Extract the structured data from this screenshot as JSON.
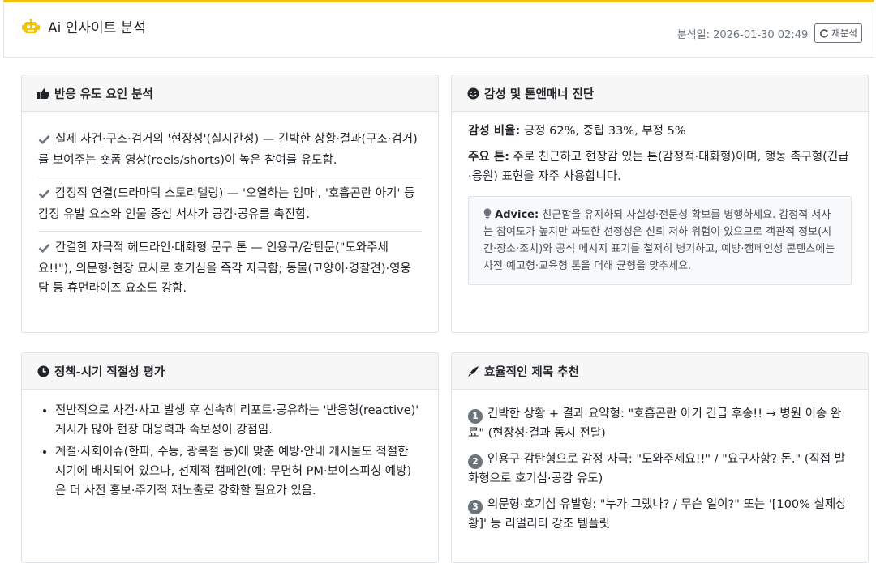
{
  "header": {
    "title": "Ai 인사이트 분석",
    "date_label": "분석일: 2026-01-30 02:49",
    "reanalyze_label": "재분석"
  },
  "response_factors": {
    "title": "반응 유도 요인 분석",
    "items": [
      "실제 사건·구조·검거의 '현장성'(실시간성) — 긴박한 상황·결과(구조·검거)를 보여주는 숏폼 영상(reels/shorts)이 높은 참여를 유도함.",
      "감정적 연결(드라마틱 스토리텔링) — '오열하는 엄마', '호흡곤란 아기' 등 감정 유발 요소와 인물 중심 서사가 공감·공유를 촉진함.",
      "간결한 자극적 헤드라인·대화형 문구 톤 — 인용구/감탄문(\"도와주세요!!\"), 의문형·현장 묘사로 호기심을 즉각 자극함; 동물(고양이·경찰견)·영웅담 등 휴먼라이즈 요소도 강함."
    ]
  },
  "sentiment": {
    "title": "감성 및 톤앤매너 진단",
    "ratio_label": "감성 비율:",
    "ratio_value": " 긍정 62%, 중립 33%, 부정 5%",
    "tone_label": "주요 톤:",
    "tone_value": " 주로 친근하고 현장감 있는 톤(감정적·대화형)이며, 행동 촉구형(긴급·응원) 표현을 자주 사용합니다.",
    "advice_label": "Advice:",
    "advice_text": " 친근함을 유지하되 사실성·전문성 확보를 병행하세요. 감정적 서사는 참여도가 높지만 과도한 선정성은 신뢰 저하 위험이 있으므로 객관적 정보(시간·장소·조치)와 공식 메시지 표기를 철저히 병기하고, 예방·캠페인성 콘텐츠에는 사전 예고형·교육형 톤을 더해 균형을 맞추세요."
  },
  "timing": {
    "title": "정책-시기 적절성 평가",
    "items": [
      "전반적으로 사건·사고 발생 후 신속히 리포트·공유하는 '반응형(reactive)' 게시가 많아 현장 대응력과 속보성이 강점임.",
      "계절·사회이슈(한파, 수능, 광복절 등)에 맞춘 예방·안내 게시물도 적절한 시기에 배치되어 있으나, 선제적 캠페인(예: 무면허 PM·보이스피싱 예방)은 더 사전 홍보·주기적 재노출로 강화할 필요가 있음."
    ]
  },
  "titles": {
    "title": "효율적인 제목 추천",
    "items": [
      {
        "num": "1",
        "text": "긴박한 상황 + 결과 요약형: \"호흡곤란 아기 긴급 후송!! → 병원 이송 완료\" (현장성·결과 동시 전달)"
      },
      {
        "num": "2",
        "text": "인용구·감탄형으로 감정 자극: \"도와주세요!!\" / \"요구사항? 돈.\" (직접 발화형으로 호기심·공감 유도)"
      },
      {
        "num": "3",
        "text": "의문형·호기심 유발형: \"누가 그랬나? / 무슨 일이?\" 또는 '[100% 실제상황]' 등 리얼리티 강조 템플릿"
      }
    ]
  },
  "colors": {
    "accent": "#f1c40f",
    "muted": "#6c757d"
  }
}
